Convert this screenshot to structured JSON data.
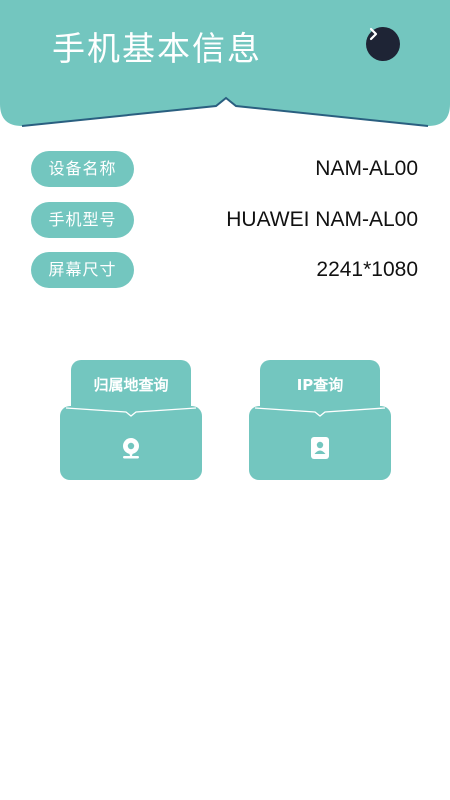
{
  "header": {
    "title": "手机基本信息",
    "next_icon": "chevron-right-icon",
    "accent_color": "#73c6bf"
  },
  "info": [
    {
      "label": "设备名称",
      "value": "NAM-AL00"
    },
    {
      "label": "手机型号",
      "value": "HUAWEI NAM-AL00"
    },
    {
      "label": "屏幕尺寸",
      "value": "2241*1080"
    }
  ],
  "cards": [
    {
      "label": "归属地查询",
      "icon": "location-icon"
    },
    {
      "label": "IP查询",
      "icon": "phone-contact-icon"
    }
  ]
}
